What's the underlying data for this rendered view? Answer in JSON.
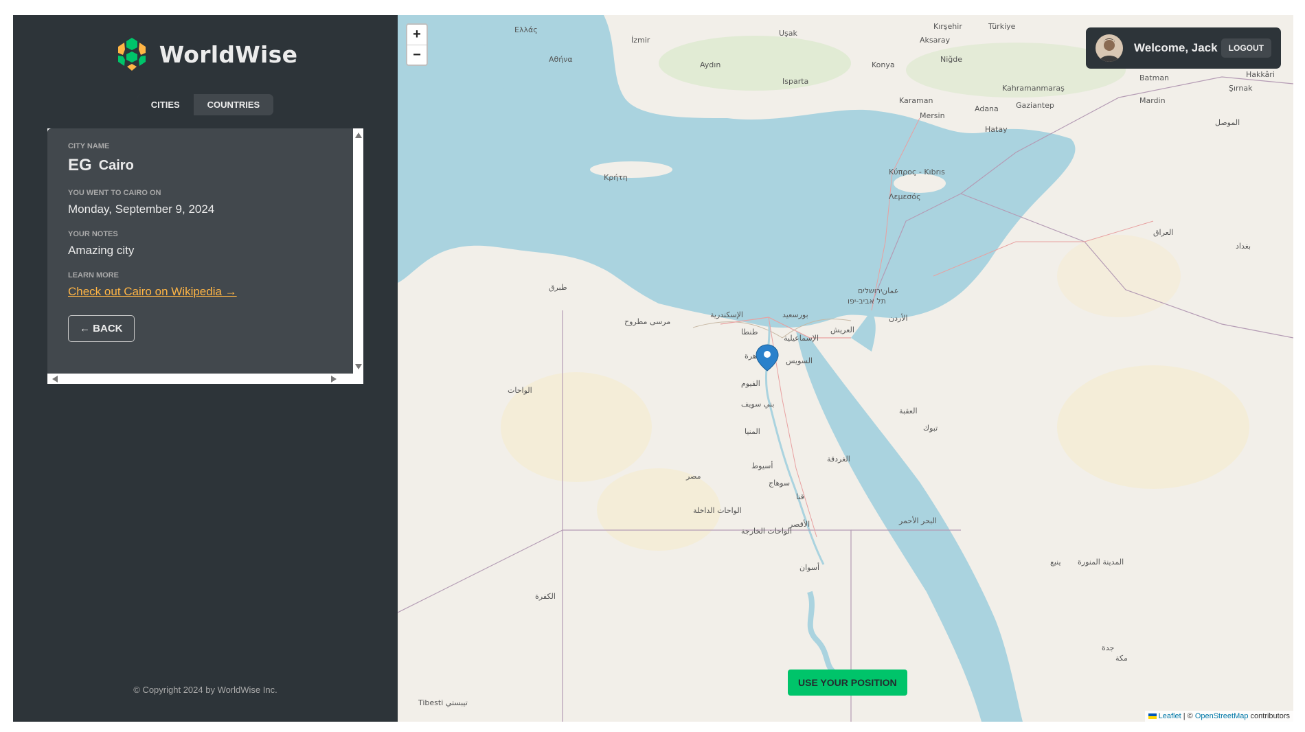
{
  "app": {
    "name": "WorldWise"
  },
  "tabs": [
    {
      "label": "CITIES",
      "active": true
    },
    {
      "label": "COUNTRIES",
      "active": false
    }
  ],
  "city": {
    "name_label": "CITY NAME",
    "flag_code": "EG",
    "name": "Cairo",
    "date_label": "YOU WENT TO CAIRO ON",
    "date": "Monday, September 9, 2024",
    "notes_label": "YOUR NOTES",
    "notes": "Amazing city",
    "learn_label": "LEARN MORE",
    "wiki_link": "Check out Cairo on Wikipedia →",
    "back": "← BACK"
  },
  "footer": {
    "copyright": "© Copyright 2024 by WorldWise Inc."
  },
  "map": {
    "zoom_in": "+",
    "zoom_out": "−",
    "user": {
      "welcome": "Welcome, Jack",
      "logout": "LOGOUT"
    },
    "use_position": "USE YOUR POSITION",
    "attribution": {
      "leaflet": "Leaflet",
      "sep": " | © ",
      "osm": "OpenStreetMap",
      "suffix": " contributors"
    },
    "labels": {
      "athens": "Αθήνα",
      "izmir": "İzmir",
      "aydin": "Aydın",
      "isparta": "Isparta",
      "konya": "Konya",
      "aksaray": "Aksaray",
      "nigde": "Niğde",
      "adana": "Adana",
      "gaziantep": "Gaziantep",
      "kahramanmaras": "Kahramanmaraş",
      "mardin": "Mardin",
      "batman": "Batman",
      "hatay": "Hatay",
      "cyprus": "Κύπρος - Kıbrıs",
      "lemesos": "Λεμεσός",
      "karaman": "Karaman",
      "mersin": "Mersin",
      "tel_aviv": "תל אביב-יפו",
      "jerusalem": "ירושלים",
      "amman": "عمان",
      "alexandria": "الإسكندرية",
      "cairo": "القاهرة",
      "suez": "السويس",
      "ismailia": "الإسماعيلية",
      "port_said": "بورسعيد",
      "tanta": "طنطا",
      "aswan": "أسوان",
      "luxor": "الأقصر",
      "qena": "قنا",
      "sohag": "سوهاج",
      "hurghada": "الغردقة",
      "tabuk": "تبوك",
      "medina": "المدينة المنورة",
      "mecca": "مكة",
      "jeddah": "جدة",
      "yanbu": "ينبع",
      "baghdad": "بغداد",
      "iraq": "العراق",
      "mosul": "الموصل",
      "aqaba": "العقبة",
      "egypt": "مصر",
      "marsa_matruh": "مرسى مطروح",
      "siwa": "الواحات",
      "dakhla": "الواحات الداخلة",
      "kharga": "الواحات الخارجة",
      "fayoum": "الفيوم",
      "minya": "المنيا",
      "asyut": "أسيوط",
      "beni_suef": "بني سويف",
      "tibesti": "Tibesti تيبستي",
      "tobruk": "طبرق",
      "kufra": "الكفرة",
      "jordan": "الأردن",
      "arish": "العريش",
      "red_sea": "البحر الأحمر",
      "crete": "Κρήτη",
      "sirnak": "Şırnak",
      "hakkari": "Hakkâri",
      "turkiye": "Türkiye",
      "kirsehir": "Kırşehir",
      "usak": "Uşak",
      "ellas": "Ελλάς"
    }
  }
}
